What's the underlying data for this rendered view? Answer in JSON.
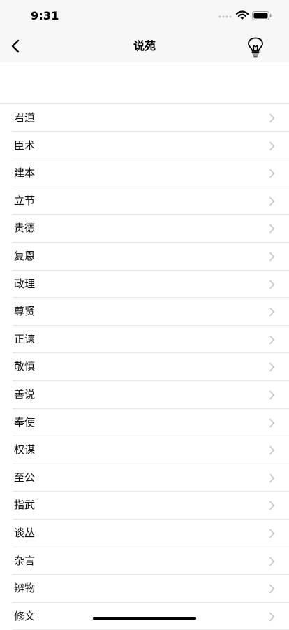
{
  "status_bar": {
    "time": "9:31"
  },
  "nav": {
    "title": "说苑"
  },
  "list": {
    "items": [
      "君道",
      "臣术",
      "建本",
      "立节",
      "贵德",
      "复恩",
      "政理",
      "尊贤",
      "正谏",
      "敬慎",
      "善说",
      "奉使",
      "权谋",
      "至公",
      "指武",
      "谈丛",
      "杂言",
      "辨物",
      "修文"
    ]
  },
  "icons": {
    "back": "chevron-left-icon",
    "hint": "lightbulb-icon",
    "row_accessory": "chevron-right-icon"
  }
}
